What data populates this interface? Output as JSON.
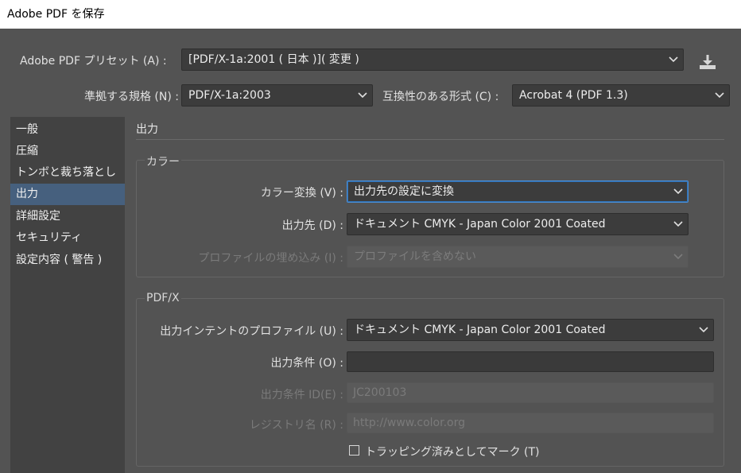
{
  "window": {
    "title": "Adobe PDF を保存"
  },
  "top": {
    "preset_label": "Adobe PDF プリセット (A) :",
    "preset_value": "[PDF/X-1a:2001 ( 日本 )]( 変更 )",
    "standard_label": "準拠する規格 (N) :",
    "standard_value": "PDF/X-1a:2003",
    "compat_label": "互換性のある形式 (C) :",
    "compat_value": "Acrobat 4 (PDF 1.3)"
  },
  "sidebar": {
    "items": [
      {
        "label": "一般"
      },
      {
        "label": "圧縮"
      },
      {
        "label": "トンボと裁ち落とし"
      },
      {
        "label": "出力"
      },
      {
        "label": "詳細設定"
      },
      {
        "label": "セキュリティ"
      },
      {
        "label": "設定内容 ( 警告 )"
      }
    ],
    "active_index": 3
  },
  "main": {
    "section_title": "出力",
    "color_group": {
      "title": "カラー",
      "conversion_label": "カラー変換 (V) :",
      "conversion_value": "出力先の設定に変換",
      "destination_label": "出力先 (D) :",
      "destination_value": "ドキュメント CMYK - Japan Color 2001 Coated",
      "embed_label": "プロファイルの埋め込み (I) :",
      "embed_value": "プロファイルを含めない"
    },
    "pdfx_group": {
      "title": "PDF/X",
      "intent_label": "出力インテントのプロファイル (U) :",
      "intent_value": "ドキュメント CMYK - Japan Color 2001 Coated",
      "condition_label": "出力条件 (O) :",
      "condition_value": "",
      "condition_id_label": "出力条件 ID(E) :",
      "condition_id_value": "JC200103",
      "registry_label": "レジストリ名 (R) :",
      "registry_value": "http://www.color.org",
      "trapped_label": "トラッピング済みとしてマーク (T)",
      "trapped_checked": false
    }
  },
  "icons": {
    "save_preset": "download-icon",
    "dropdown": "chevron-down-icon"
  }
}
